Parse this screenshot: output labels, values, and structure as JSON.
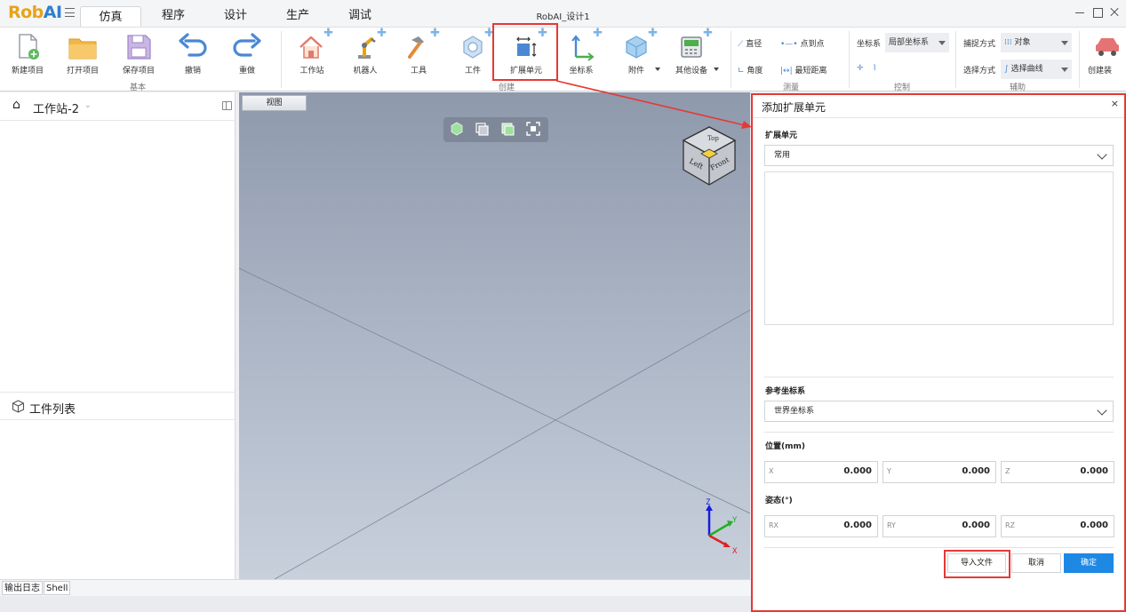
{
  "app": {
    "logo_rob": "Rob",
    "logo_ai": "AI",
    "window_title": "RobAI_设计1"
  },
  "tabs": [
    {
      "label": "仿真",
      "active": true
    },
    {
      "label": "程序"
    },
    {
      "label": "设计"
    },
    {
      "label": "生产"
    },
    {
      "label": "调试"
    }
  ],
  "ribbon": {
    "basic": {
      "group_label": "基本",
      "new_project": "新建项目",
      "open_project": "打开项目",
      "save_project": "保存项目",
      "undo": "撤销",
      "redo": "重做"
    },
    "create": {
      "group_label": "创建",
      "workstation": "工作站",
      "robot": "机器人",
      "tool": "工具",
      "workpiece": "工件",
      "extension_unit": "扩展单元",
      "coord_system": "坐标系",
      "attachment": "附件",
      "other_device": "其他设备"
    },
    "measure": {
      "group_label": "测量",
      "diameter": "直径",
      "point_to_point": "点到点",
      "angle": "角度",
      "shortest_distance": "最短距离"
    },
    "control": {
      "group_label": "控制",
      "coord_label": "坐标系",
      "coord_value": "局部坐标系"
    },
    "assist": {
      "group_label": "辅助",
      "capture_label": "捕捉方式",
      "capture_value": "对象",
      "select_label": "选择方式",
      "select_value": "选择曲线"
    },
    "create_device": "创建装"
  },
  "left_panel": {
    "station_title": "工作站-2",
    "workpiece_list_title": "工件列表"
  },
  "viewport": {
    "view_tab": "视图",
    "cube_top": "Top",
    "cube_left": "Left",
    "cube_front": "Front",
    "axis_x": "X",
    "axis_y": "Y",
    "axis_z": "Z"
  },
  "bottom_tabs": [
    "输出日志",
    "Shell"
  ],
  "dialog": {
    "title": "添加扩展单元",
    "close": "×",
    "ext_unit_label": "扩展单元",
    "ext_unit_value": "常用",
    "ref_coord_label": "参考坐标系",
    "ref_coord_value": "世界坐标系",
    "position_label": "位置(mm)",
    "position": [
      {
        "label": "X",
        "value": "0.000"
      },
      {
        "label": "Y",
        "value": "0.000"
      },
      {
        "label": "Z",
        "value": "0.000"
      }
    ],
    "orientation_label": "姿态(°)",
    "orientation": [
      {
        "label": "RX",
        "value": "0.000"
      },
      {
        "label": "RY",
        "value": "0.000"
      },
      {
        "label": "RZ",
        "value": "0.000"
      }
    ],
    "import_file": "导入文件",
    "cancel": "取消",
    "confirm": "确定"
  },
  "colors": {
    "accent": "#1e88e5",
    "logo_orange": "#e8a317",
    "logo_blue": "#2f7fd0",
    "annotation_red": "#e53935"
  }
}
